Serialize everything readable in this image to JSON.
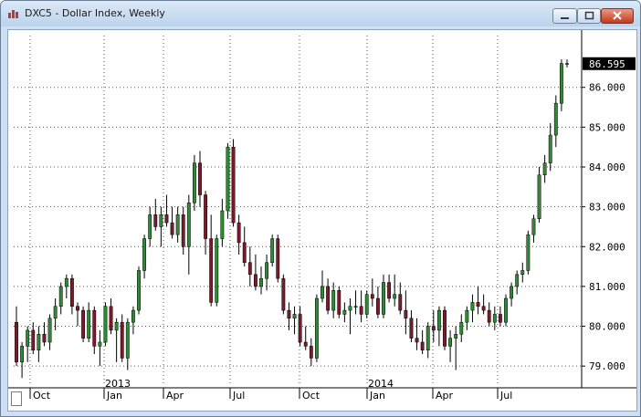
{
  "window": {
    "title": "DXC5 - Dollar Index, Weekly",
    "icons": {
      "app": "bar-chart-icon",
      "minimize": "minimize-icon",
      "maximize": "maximize-icon",
      "close": "close-icon"
    }
  },
  "colors": {
    "up": "#2e8b34",
    "down": "#7a1a2a",
    "last_price_bg": "#000000",
    "grid": "#555555"
  },
  "chart_data": {
    "type": "candlestick",
    "title": "DXC5 - Dollar Index, Weekly",
    "last_price": "86.595",
    "y_ticks": [
      "79.000",
      "80.000",
      "81.000",
      "82.000",
      "83.000",
      "84.000",
      "85.000",
      "86.000"
    ],
    "ylim": [
      78.5,
      87.3
    ],
    "x_month_labels": [
      "Oct",
      "Jan",
      "Apr",
      "Jul",
      "Oct",
      "Jan",
      "Apr",
      "Jul"
    ],
    "x_year_labels": [
      "2013",
      "2014"
    ],
    "grid": true,
    "candles": [
      {
        "o": 80.1,
        "h": 80.5,
        "l": 79.0,
        "c": 79.1
      },
      {
        "o": 79.1,
        "h": 79.6,
        "l": 78.7,
        "c": 79.5
      },
      {
        "o": 79.5,
        "h": 80.0,
        "l": 79.1,
        "c": 79.9
      },
      {
        "o": 79.9,
        "h": 80.1,
        "l": 79.3,
        "c": 79.4
      },
      {
        "o": 79.4,
        "h": 80.0,
        "l": 79.1,
        "c": 79.8
      },
      {
        "o": 79.8,
        "h": 80.1,
        "l": 79.5,
        "c": 79.6
      },
      {
        "o": 79.6,
        "h": 80.3,
        "l": 79.4,
        "c": 80.2
      },
      {
        "o": 80.2,
        "h": 80.7,
        "l": 79.9,
        "c": 80.5
      },
      {
        "o": 80.5,
        "h": 81.1,
        "l": 80.3,
        "c": 81.0
      },
      {
        "o": 81.0,
        "h": 81.3,
        "l": 80.7,
        "c": 81.2
      },
      {
        "o": 81.2,
        "h": 81.3,
        "l": 80.3,
        "c": 80.5
      },
      {
        "o": 80.5,
        "h": 80.6,
        "l": 80.0,
        "c": 80.4
      },
      {
        "o": 80.4,
        "h": 80.5,
        "l": 79.6,
        "c": 79.7
      },
      {
        "o": 79.7,
        "h": 80.6,
        "l": 79.6,
        "c": 80.4
      },
      {
        "o": 80.4,
        "h": 80.5,
        "l": 79.3,
        "c": 79.5
      },
      {
        "o": 79.5,
        "h": 79.9,
        "l": 79.0,
        "c": 79.6
      },
      {
        "o": 79.6,
        "h": 80.6,
        "l": 79.5,
        "c": 80.5
      },
      {
        "o": 80.5,
        "h": 80.7,
        "l": 79.8,
        "c": 79.9
      },
      {
        "o": 79.9,
        "h": 80.2,
        "l": 79.1,
        "c": 80.1
      },
      {
        "o": 80.1,
        "h": 80.3,
        "l": 79.1,
        "c": 79.2
      },
      {
        "o": 79.2,
        "h": 80.2,
        "l": 78.9,
        "c": 80.1
      },
      {
        "o": 80.1,
        "h": 80.5,
        "l": 79.8,
        "c": 80.4
      },
      {
        "o": 80.4,
        "h": 81.5,
        "l": 80.3,
        "c": 81.4
      },
      {
        "o": 81.4,
        "h": 82.3,
        "l": 81.2,
        "c": 82.2
      },
      {
        "o": 82.2,
        "h": 83.0,
        "l": 82.0,
        "c": 82.8
      },
      {
        "o": 82.8,
        "h": 83.2,
        "l": 82.4,
        "c": 82.5
      },
      {
        "o": 82.5,
        "h": 83.0,
        "l": 82.0,
        "c": 82.8
      },
      {
        "o": 82.8,
        "h": 83.3,
        "l": 82.5,
        "c": 82.6
      },
      {
        "o": 82.6,
        "h": 83.0,
        "l": 82.2,
        "c": 82.3
      },
      {
        "o": 82.3,
        "h": 83.0,
        "l": 82.1,
        "c": 82.8
      },
      {
        "o": 82.8,
        "h": 83.0,
        "l": 81.8,
        "c": 82.0
      },
      {
        "o": 82.0,
        "h": 83.3,
        "l": 81.3,
        "c": 83.1
      },
      {
        "o": 83.1,
        "h": 84.3,
        "l": 82.9,
        "c": 84.1
      },
      {
        "o": 84.1,
        "h": 84.4,
        "l": 83.0,
        "c": 83.3
      },
      {
        "o": 83.3,
        "h": 83.4,
        "l": 81.8,
        "c": 82.2
      },
      {
        "o": 82.2,
        "h": 82.8,
        "l": 80.5,
        "c": 80.6
      },
      {
        "o": 80.6,
        "h": 82.3,
        "l": 80.5,
        "c": 82.2
      },
      {
        "o": 82.2,
        "h": 83.2,
        "l": 82.0,
        "c": 82.9
      },
      {
        "o": 82.9,
        "h": 84.6,
        "l": 82.7,
        "c": 84.5
      },
      {
        "o": 84.5,
        "h": 84.7,
        "l": 82.5,
        "c": 82.6
      },
      {
        "o": 82.6,
        "h": 82.8,
        "l": 81.8,
        "c": 82.1
      },
      {
        "o": 82.1,
        "h": 82.5,
        "l": 81.5,
        "c": 81.6
      },
      {
        "o": 81.6,
        "h": 82.0,
        "l": 81.0,
        "c": 81.3
      },
      {
        "o": 81.3,
        "h": 81.8,
        "l": 80.9,
        "c": 81.0
      },
      {
        "o": 81.0,
        "h": 81.5,
        "l": 80.8,
        "c": 81.2
      },
      {
        "o": 81.2,
        "h": 81.8,
        "l": 80.9,
        "c": 81.6
      },
      {
        "o": 81.6,
        "h": 82.3,
        "l": 81.5,
        "c": 82.2
      },
      {
        "o": 82.2,
        "h": 82.3,
        "l": 81.1,
        "c": 81.2
      },
      {
        "o": 81.2,
        "h": 81.3,
        "l": 80.3,
        "c": 80.4
      },
      {
        "o": 80.4,
        "h": 80.6,
        "l": 79.9,
        "c": 80.2
      },
      {
        "o": 80.2,
        "h": 80.5,
        "l": 79.8,
        "c": 80.3
      },
      {
        "o": 80.3,
        "h": 80.5,
        "l": 79.5,
        "c": 79.6
      },
      {
        "o": 79.6,
        "h": 80.0,
        "l": 79.4,
        "c": 79.5
      },
      {
        "o": 79.5,
        "h": 79.7,
        "l": 79.0,
        "c": 79.2
      },
      {
        "o": 79.2,
        "h": 80.8,
        "l": 79.1,
        "c": 80.7
      },
      {
        "o": 80.7,
        "h": 81.4,
        "l": 80.6,
        "c": 81.0
      },
      {
        "o": 81.0,
        "h": 81.2,
        "l": 80.3,
        "c": 80.4
      },
      {
        "o": 80.4,
        "h": 81.1,
        "l": 80.2,
        "c": 80.9
      },
      {
        "o": 80.9,
        "h": 81.0,
        "l": 80.2,
        "c": 80.3
      },
      {
        "o": 80.3,
        "h": 80.6,
        "l": 80.1,
        "c": 80.4
      },
      {
        "o": 80.4,
        "h": 80.7,
        "l": 79.8,
        "c": 80.5
      },
      {
        "o": 80.5,
        "h": 80.9,
        "l": 80.3,
        "c": 80.5
      },
      {
        "o": 80.5,
        "h": 80.9,
        "l": 80.1,
        "c": 80.3
      },
      {
        "o": 80.3,
        "h": 80.9,
        "l": 80.2,
        "c": 80.8
      },
      {
        "o": 80.8,
        "h": 81.2,
        "l": 80.5,
        "c": 80.7
      },
      {
        "o": 80.7,
        "h": 81.0,
        "l": 80.2,
        "c": 80.3
      },
      {
        "o": 80.3,
        "h": 81.3,
        "l": 80.2,
        "c": 81.1
      },
      {
        "o": 81.1,
        "h": 81.3,
        "l": 80.6,
        "c": 80.7
      },
      {
        "o": 80.7,
        "h": 81.3,
        "l": 80.5,
        "c": 80.8
      },
      {
        "o": 80.8,
        "h": 81.1,
        "l": 80.3,
        "c": 80.4
      },
      {
        "o": 80.4,
        "h": 80.9,
        "l": 79.8,
        "c": 80.2
      },
      {
        "o": 80.2,
        "h": 80.4,
        "l": 79.6,
        "c": 79.7
      },
      {
        "o": 79.7,
        "h": 80.2,
        "l": 79.4,
        "c": 79.6
      },
      {
        "o": 79.6,
        "h": 79.9,
        "l": 79.3,
        "c": 79.4
      },
      {
        "o": 79.4,
        "h": 80.1,
        "l": 79.2,
        "c": 80.0
      },
      {
        "o": 80.0,
        "h": 80.4,
        "l": 79.6,
        "c": 79.9
      },
      {
        "o": 79.9,
        "h": 80.5,
        "l": 79.5,
        "c": 80.4
      },
      {
        "o": 80.4,
        "h": 80.5,
        "l": 79.4,
        "c": 79.5
      },
      {
        "o": 79.5,
        "h": 79.9,
        "l": 79.1,
        "c": 79.7
      },
      {
        "o": 79.7,
        "h": 80.0,
        "l": 78.9,
        "c": 79.8
      },
      {
        "o": 79.8,
        "h": 80.3,
        "l": 79.6,
        "c": 80.1
      },
      {
        "o": 80.1,
        "h": 80.5,
        "l": 79.9,
        "c": 80.4
      },
      {
        "o": 80.4,
        "h": 80.8,
        "l": 80.1,
        "c": 80.6
      },
      {
        "o": 80.6,
        "h": 81.0,
        "l": 80.3,
        "c": 80.5
      },
      {
        "o": 80.5,
        "h": 80.8,
        "l": 80.3,
        "c": 80.4
      },
      {
        "o": 80.4,
        "h": 80.6,
        "l": 80.0,
        "c": 80.1
      },
      {
        "o": 80.1,
        "h": 80.5,
        "l": 79.9,
        "c": 80.3
      },
      {
        "o": 80.3,
        "h": 80.5,
        "l": 80.0,
        "c": 80.1
      },
      {
        "o": 80.1,
        "h": 80.8,
        "l": 80.0,
        "c": 80.7
      },
      {
        "o": 80.7,
        "h": 81.1,
        "l": 80.5,
        "c": 81.0
      },
      {
        "o": 81.0,
        "h": 81.4,
        "l": 80.8,
        "c": 81.3
      },
      {
        "o": 81.3,
        "h": 81.6,
        "l": 81.1,
        "c": 81.4
      },
      {
        "o": 81.4,
        "h": 82.4,
        "l": 81.3,
        "c": 82.3
      },
      {
        "o": 82.3,
        "h": 82.8,
        "l": 82.1,
        "c": 82.7
      },
      {
        "o": 82.7,
        "h": 84.0,
        "l": 82.6,
        "c": 83.8
      },
      {
        "o": 83.8,
        "h": 84.3,
        "l": 83.6,
        "c": 84.1
      },
      {
        "o": 84.1,
        "h": 85.1,
        "l": 83.9,
        "c": 84.8
      },
      {
        "o": 84.8,
        "h": 85.8,
        "l": 84.5,
        "c": 85.6
      },
      {
        "o": 85.6,
        "h": 86.7,
        "l": 85.4,
        "c": 86.6
      },
      {
        "o": 86.6,
        "h": 86.7,
        "l": 86.5,
        "c": 86.6
      }
    ]
  }
}
